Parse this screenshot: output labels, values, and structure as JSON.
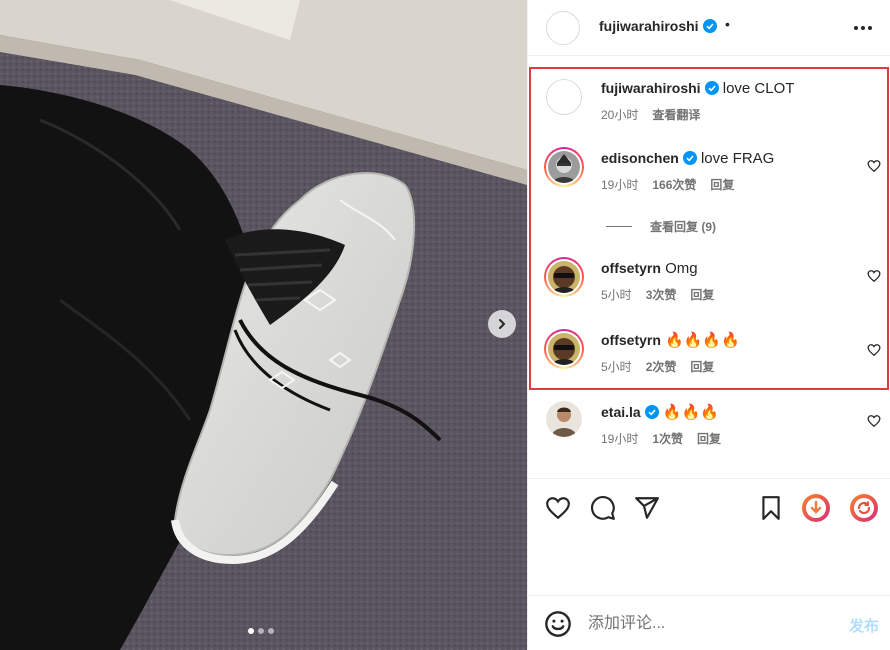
{
  "post": {
    "author": "fujiwarahiroshi",
    "header_bullet": "•",
    "icons": {
      "verified": "verified-badge-icon",
      "more": "more-options-icon",
      "next": "chevron-right-icon"
    },
    "carousel": {
      "total_slides": 3,
      "active_slide": 1
    }
  },
  "caption": {
    "username": "fujiwarahiroshi",
    "text": "love CLOT",
    "time": "20小时",
    "translate": "查看翻译"
  },
  "comments": [
    {
      "username": "edisonchen",
      "verified": true,
      "text": "love FRAG",
      "time": "19小时",
      "likes": "166次赞",
      "reply": "回复",
      "avatar": "edisonchen-avatar",
      "story_ring": true
    },
    {
      "username": "offsetyrn",
      "verified": false,
      "text": "Omg",
      "time": "5小时",
      "likes": "3次赞",
      "reply": "回复",
      "avatar": "offsetyrn-avatar",
      "story_ring": true
    },
    {
      "username": "offsetyrn",
      "verified": false,
      "text": "🔥🔥🔥🔥",
      "time": "5小时",
      "likes": "2次赞",
      "reply": "回复",
      "avatar": "offsetyrn-avatar",
      "story_ring": true
    },
    {
      "username": "etai.la",
      "verified": true,
      "text": "🔥🔥🔥",
      "time": "19小时",
      "likes": "1次赞",
      "reply": "回复",
      "avatar": "etai-avatar",
      "story_ring": false
    }
  ],
  "view_replies": "查看回复 (9)",
  "actions": [
    "like-icon",
    "comment-icon",
    "share-icon",
    "save-icon",
    "download-extension-icon",
    "refresh-extension-icon"
  ],
  "add_comment": {
    "placeholder": "添加评论...",
    "post_label": "发布",
    "emoji_icon": "emoji-icon"
  },
  "colors": {
    "highlight_border": "#e0393e",
    "verified_blue": "#0095f6",
    "post_button_disabled": "#b2dffc",
    "muted_text": "#737373"
  }
}
